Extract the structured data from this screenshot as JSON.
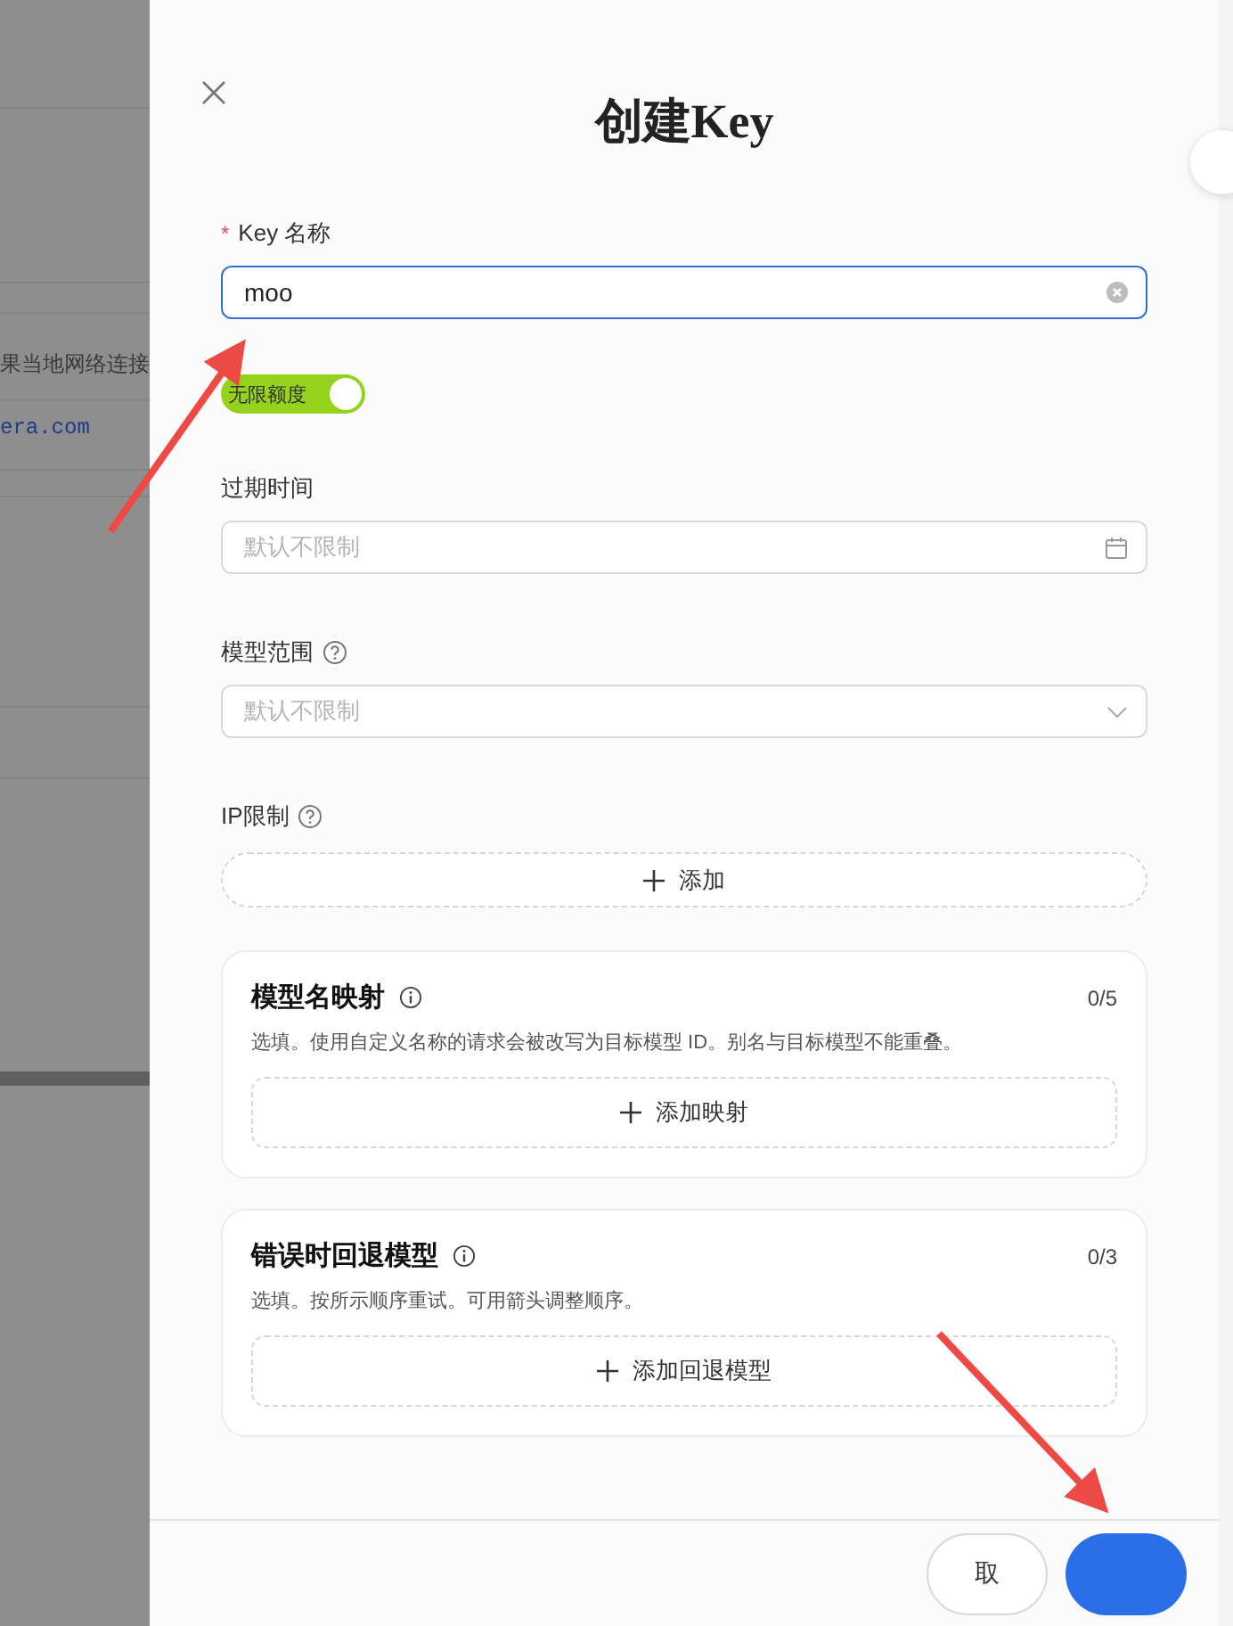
{
  "background_page": {
    "texts": [
      {
        "kind": "text",
        "text": "果当地网络连接"
      },
      {
        "kind": "code",
        "text": "era.com"
      }
    ]
  },
  "drawer": {
    "title": "创建Key",
    "key_name": {
      "label": "Key 名称",
      "required_mark": "*",
      "value": "moo",
      "focused": true
    },
    "unlimited_quota": {
      "label": "无限额度",
      "on": true
    },
    "expiry": {
      "label": "过期时间",
      "placeholder": "默认不限制"
    },
    "model_scope": {
      "label": "模型范围",
      "placeholder": "默认不限制"
    },
    "ip_limit": {
      "label": "IP限制",
      "add_button": "添加"
    },
    "sections": [
      {
        "title": "模型名映射",
        "count": "0/5",
        "description": "选填。使用自定义名称的请求会被改写为目标模型 ID。别名与目标模型不能重叠。",
        "add_button": "添加映射"
      },
      {
        "title": "错误时回退模型",
        "count": "0/3",
        "description": "选填。按所示顺序重试。可用箭头调整顺序。",
        "add_button": "添加回退模型"
      }
    ],
    "footer_buttons": [
      {
        "kind": "default",
        "label": "取"
      },
      {
        "kind": "primary"
      }
    ]
  }
}
